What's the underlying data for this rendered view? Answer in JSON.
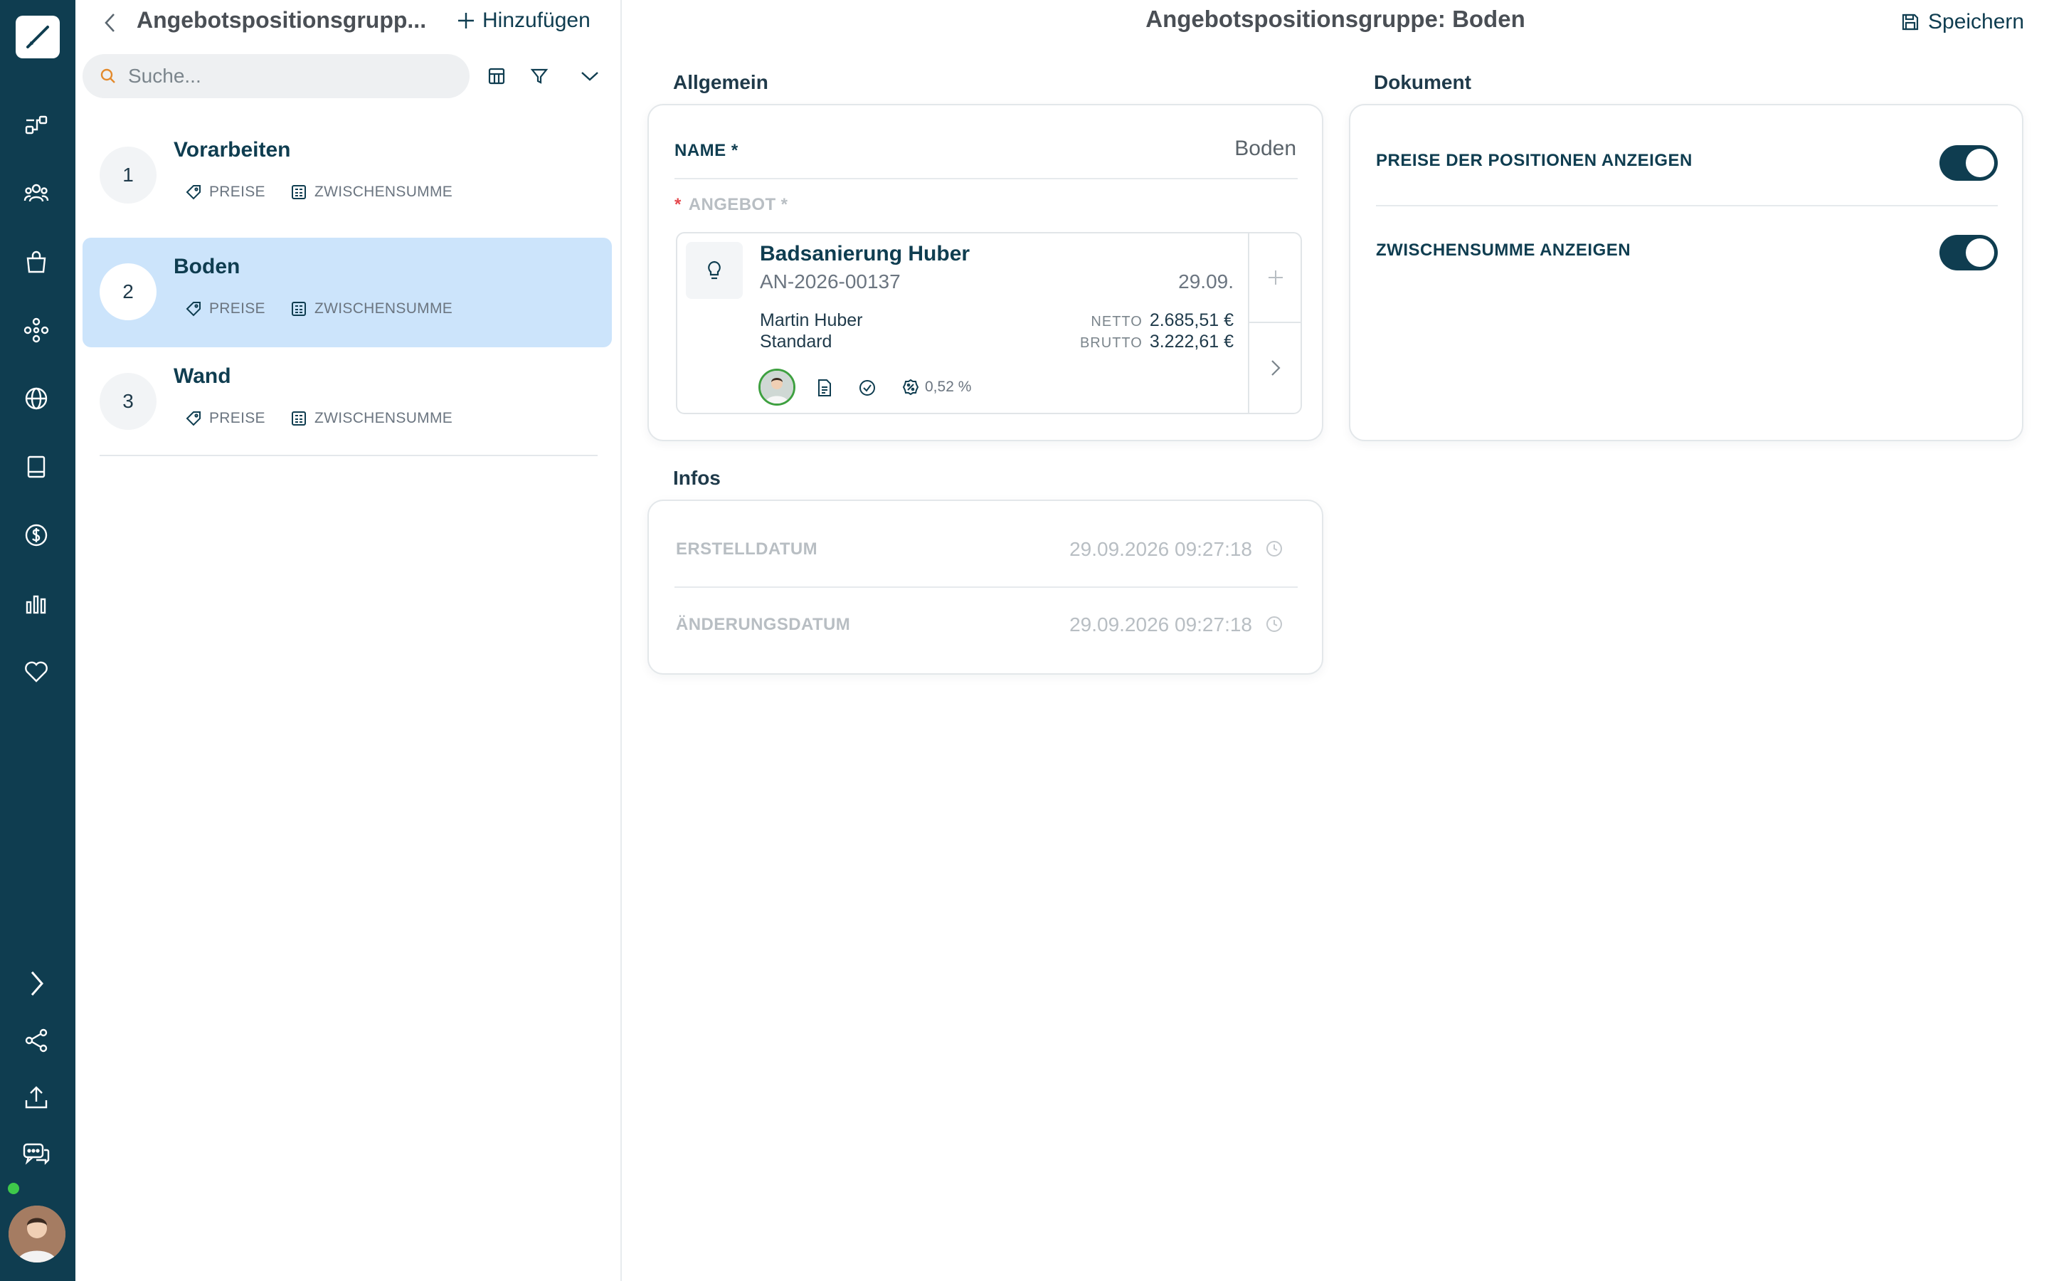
{
  "rail": {
    "icons": [
      "logo-icon",
      "organization-icon",
      "users-icon",
      "shopping-bag-icon",
      "network-icon",
      "globe-icon",
      "book-icon",
      "dollar-icon",
      "bar-chart-icon",
      "heart-icon",
      "chevron-right-icon",
      "share-icon",
      "upload-icon",
      "chat-icon"
    ],
    "status_color": "#3ec84a"
  },
  "list": {
    "title": "Angebotspositionsgrupp...",
    "add_label": "Hinzufügen",
    "search_placeholder": "Suche...",
    "items": [
      {
        "number": "1",
        "name": "Vorarbeiten",
        "tag_prices": "PREISE",
        "tag_subtotal": "ZWISCHENSUMME"
      },
      {
        "number": "2",
        "name": "Boden",
        "tag_prices": "PREISE",
        "tag_subtotal": "ZWISCHENSUMME"
      },
      {
        "number": "3",
        "name": "Wand",
        "tag_prices": "PREISE",
        "tag_subtotal": "ZWISCHENSUMME"
      }
    ]
  },
  "main": {
    "title": "Angebotspositionsgruppe: Boden",
    "save_label": "Speichern",
    "general": {
      "section_title": "Allgemein",
      "name_label": "NAME *",
      "name_value": "Boden",
      "offer_required_mark": "*",
      "offer_label": "ANGEBOT *",
      "offer": {
        "title": "Badsanierung Huber",
        "number": "AN-2026-00137",
        "date": "29.09.",
        "customer": "Martin Huber",
        "type": "Standard",
        "netto_label": "NETTO",
        "netto_value": "2.685,51 €",
        "brutto_label": "BRUTTO",
        "brutto_value": "3.222,61 €",
        "percent": "0,52 %"
      }
    },
    "document": {
      "section_title": "Dokument",
      "show_prices_label": "PREISE DER POSITIONEN ANZEIGEN",
      "show_prices": true,
      "show_subtotal_label": "ZWISCHENSUMME ANZEIGEN",
      "show_subtotal": true
    },
    "infos": {
      "section_title": "Infos",
      "created_label": "ERSTELLDATUM",
      "created_value": "29.09.2026 09:27:18",
      "changed_label": "ÄNDERUNGSDATUM",
      "changed_value": "29.09.2026 09:27:18"
    }
  },
  "colors": {
    "sidebar": "#0f3d50",
    "accent": "#0f3d50",
    "selected_row": "#cce4fb",
    "required": "#e5484d",
    "muted": "#b8bec3"
  }
}
